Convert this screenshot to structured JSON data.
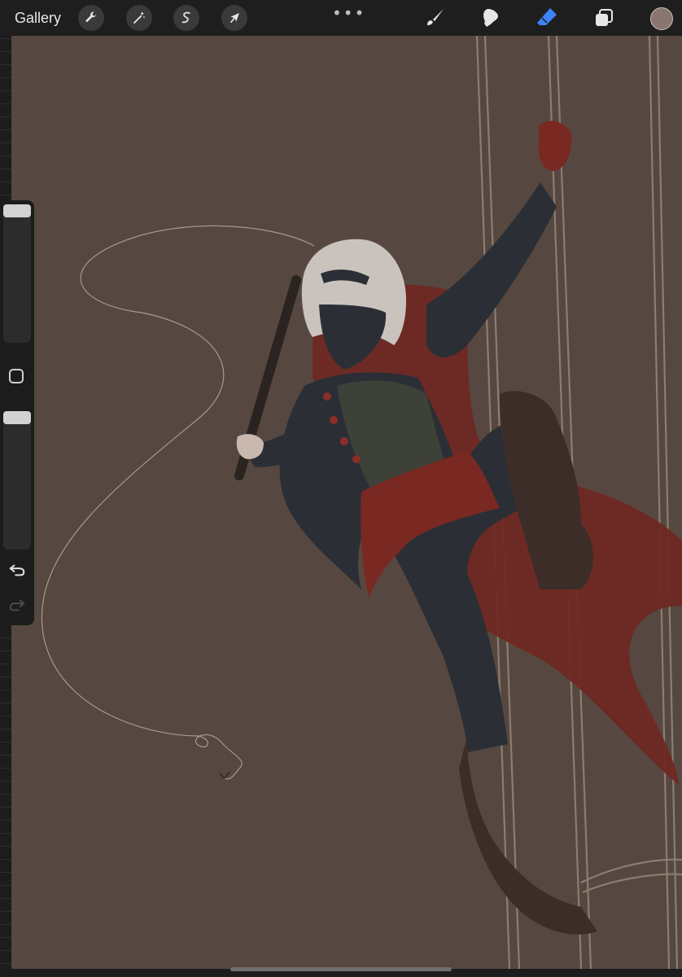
{
  "app": {
    "gallery_label": "Gallery"
  },
  "toolbar": {
    "left_tools": [
      {
        "name": "actions",
        "icon": "wrench-icon"
      },
      {
        "name": "adjustments",
        "icon": "magic-wand-icon"
      },
      {
        "name": "selection",
        "icon": "selection-icon"
      },
      {
        "name": "transform",
        "icon": "arrow-cursor-icon"
      }
    ],
    "more_label": "•••",
    "right_tools": [
      {
        "name": "brush",
        "icon": "brush-icon",
        "active": false
      },
      {
        "name": "smudge",
        "icon": "smudge-icon",
        "active": false
      },
      {
        "name": "eraser",
        "icon": "eraser-icon",
        "active": true
      },
      {
        "name": "layers",
        "icon": "layers-icon",
        "active": false
      }
    ],
    "current_color": "#8a7670"
  },
  "sidebar": {
    "brush_size_level": 1.0,
    "opacity_level": 1.0,
    "undo_icon": "undo-icon",
    "redo_icon": "redo-icon",
    "modify_icon": "square-icon"
  },
  "canvas": {
    "background_color": "#564840"
  },
  "colors": {
    "accent": "#3d82f6",
    "ui_dark": "#1e1e1e",
    "coat": "#2b2f35",
    "red": "#7c2a24",
    "hair": "#c9c2bd",
    "shirt": "#3d4138",
    "boots": "#3c2d28"
  }
}
